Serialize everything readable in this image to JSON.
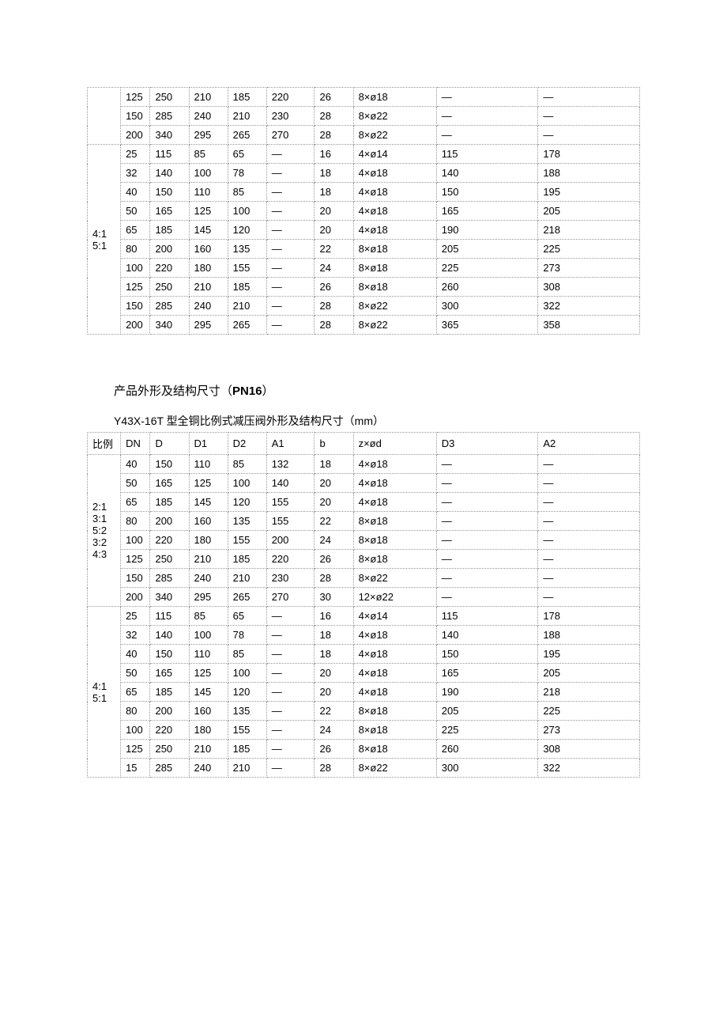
{
  "table1": {
    "group1": {
      "ratio": "",
      "rows": [
        [
          "125",
          "250",
          "210",
          "185",
          "220",
          "26",
          "8×ø18",
          "—",
          "—"
        ],
        [
          "150",
          "285",
          "240",
          "210",
          "230",
          "28",
          "8×ø22",
          "—",
          "—"
        ],
        [
          "200",
          "340",
          "295",
          "265",
          "270",
          "28",
          "8×ø22",
          "—",
          "—"
        ]
      ]
    },
    "group2": {
      "ratio": "4:1\n5:1",
      "rows": [
        [
          "25",
          "115",
          "85",
          "65",
          "—",
          "16",
          "4×ø14",
          "115",
          "178"
        ],
        [
          "32",
          "140",
          "100",
          "78",
          "—",
          "18",
          "4×ø18",
          "140",
          "188"
        ],
        [
          "40",
          "150",
          "110",
          "85",
          "—",
          "18",
          "4×ø18",
          "150",
          "195"
        ],
        [
          "50",
          "165",
          "125",
          "100",
          "—",
          "20",
          "4×ø18",
          "165",
          "205"
        ],
        [
          "65",
          "185",
          "145",
          "120",
          "—",
          "20",
          "4×ø18",
          "190",
          "218"
        ],
        [
          "80",
          "200",
          "160",
          "135",
          "—",
          "22",
          "8×ø18",
          "205",
          "225"
        ],
        [
          "100",
          "220",
          "180",
          "155",
          "—",
          "24",
          "8×ø18",
          "225",
          "273"
        ],
        [
          "125",
          "250",
          "210",
          "185",
          "—",
          "26",
          "8×ø18",
          "260",
          "308"
        ],
        [
          "150",
          "285",
          "240",
          "210",
          "—",
          "28",
          "8×ø22",
          "300",
          "322"
        ],
        [
          "200",
          "340",
          "295",
          "265",
          "—",
          "28",
          "8×ø22",
          "365",
          "358"
        ]
      ]
    }
  },
  "section_title_pre": "产品外形及结构尺寸（",
  "section_title_bold": "PN16",
  "section_title_post": "）",
  "subtitle": "Y43X-16T 型全铜比例式减压阀外形及结构尺寸（mm）",
  "table2": {
    "header": [
      "比例",
      "DN",
      "D",
      "D1",
      "D2",
      "A1",
      "b",
      "z×ød",
      "D3",
      "A2"
    ],
    "group1": {
      "ratio": "2:1\n3:1\n5:2\n3:2\n4:3",
      "rows": [
        [
          "40",
          "150",
          "110",
          "85",
          "132",
          "18",
          "4×ø18",
          "—",
          "—"
        ],
        [
          "50",
          "165",
          "125",
          "100",
          "140",
          "20",
          "4×ø18",
          "—",
          "—"
        ],
        [
          "65",
          "185",
          "145",
          "120",
          "155",
          "20",
          "4×ø18",
          "—",
          "—"
        ],
        [
          "80",
          "200",
          "160",
          "135",
          "155",
          "22",
          "8×ø18",
          "—",
          "—"
        ],
        [
          "100",
          "220",
          "180",
          "155",
          "200",
          "24",
          "8×ø18",
          "—",
          "—"
        ],
        [
          "125",
          "250",
          "210",
          "185",
          "220",
          "26",
          "8×ø18",
          "—",
          "—"
        ],
        [
          "150",
          "285",
          "240",
          "210",
          "230",
          "28",
          "8×ø22",
          "—",
          "—"
        ],
        [
          "200",
          "340",
          "295",
          "265",
          "270",
          "30",
          "12×ø22",
          "—",
          "—"
        ]
      ]
    },
    "group2": {
      "ratio": "4:1\n5:1",
      "rows": [
        [
          "25",
          "115",
          "85",
          "65",
          "—",
          "16",
          "4×ø14",
          "115",
          "178"
        ],
        [
          "32",
          "140",
          "100",
          "78",
          "—",
          "18",
          "4×ø18",
          "140",
          "188"
        ],
        [
          "40",
          "150",
          "110",
          "85",
          "—",
          "18",
          "4×ø18",
          "150",
          "195"
        ],
        [
          "50",
          "165",
          "125",
          "100",
          "—",
          "20",
          "4×ø18",
          "165",
          "205"
        ],
        [
          "65",
          "185",
          "145",
          "120",
          "—",
          "20",
          "4×ø18",
          "190",
          "218"
        ],
        [
          "80",
          "200",
          "160",
          "135",
          "—",
          "22",
          "8×ø18",
          "205",
          "225"
        ],
        [
          "100",
          "220",
          "180",
          "155",
          "—",
          "24",
          "8×ø18",
          "225",
          "273"
        ],
        [
          "125",
          "250",
          "210",
          "185",
          "—",
          "26",
          "8×ø18",
          "260",
          "308"
        ],
        [
          "15",
          "285",
          "240",
          "210",
          "—",
          "28",
          "8×ø22",
          "300",
          "322"
        ]
      ]
    }
  }
}
